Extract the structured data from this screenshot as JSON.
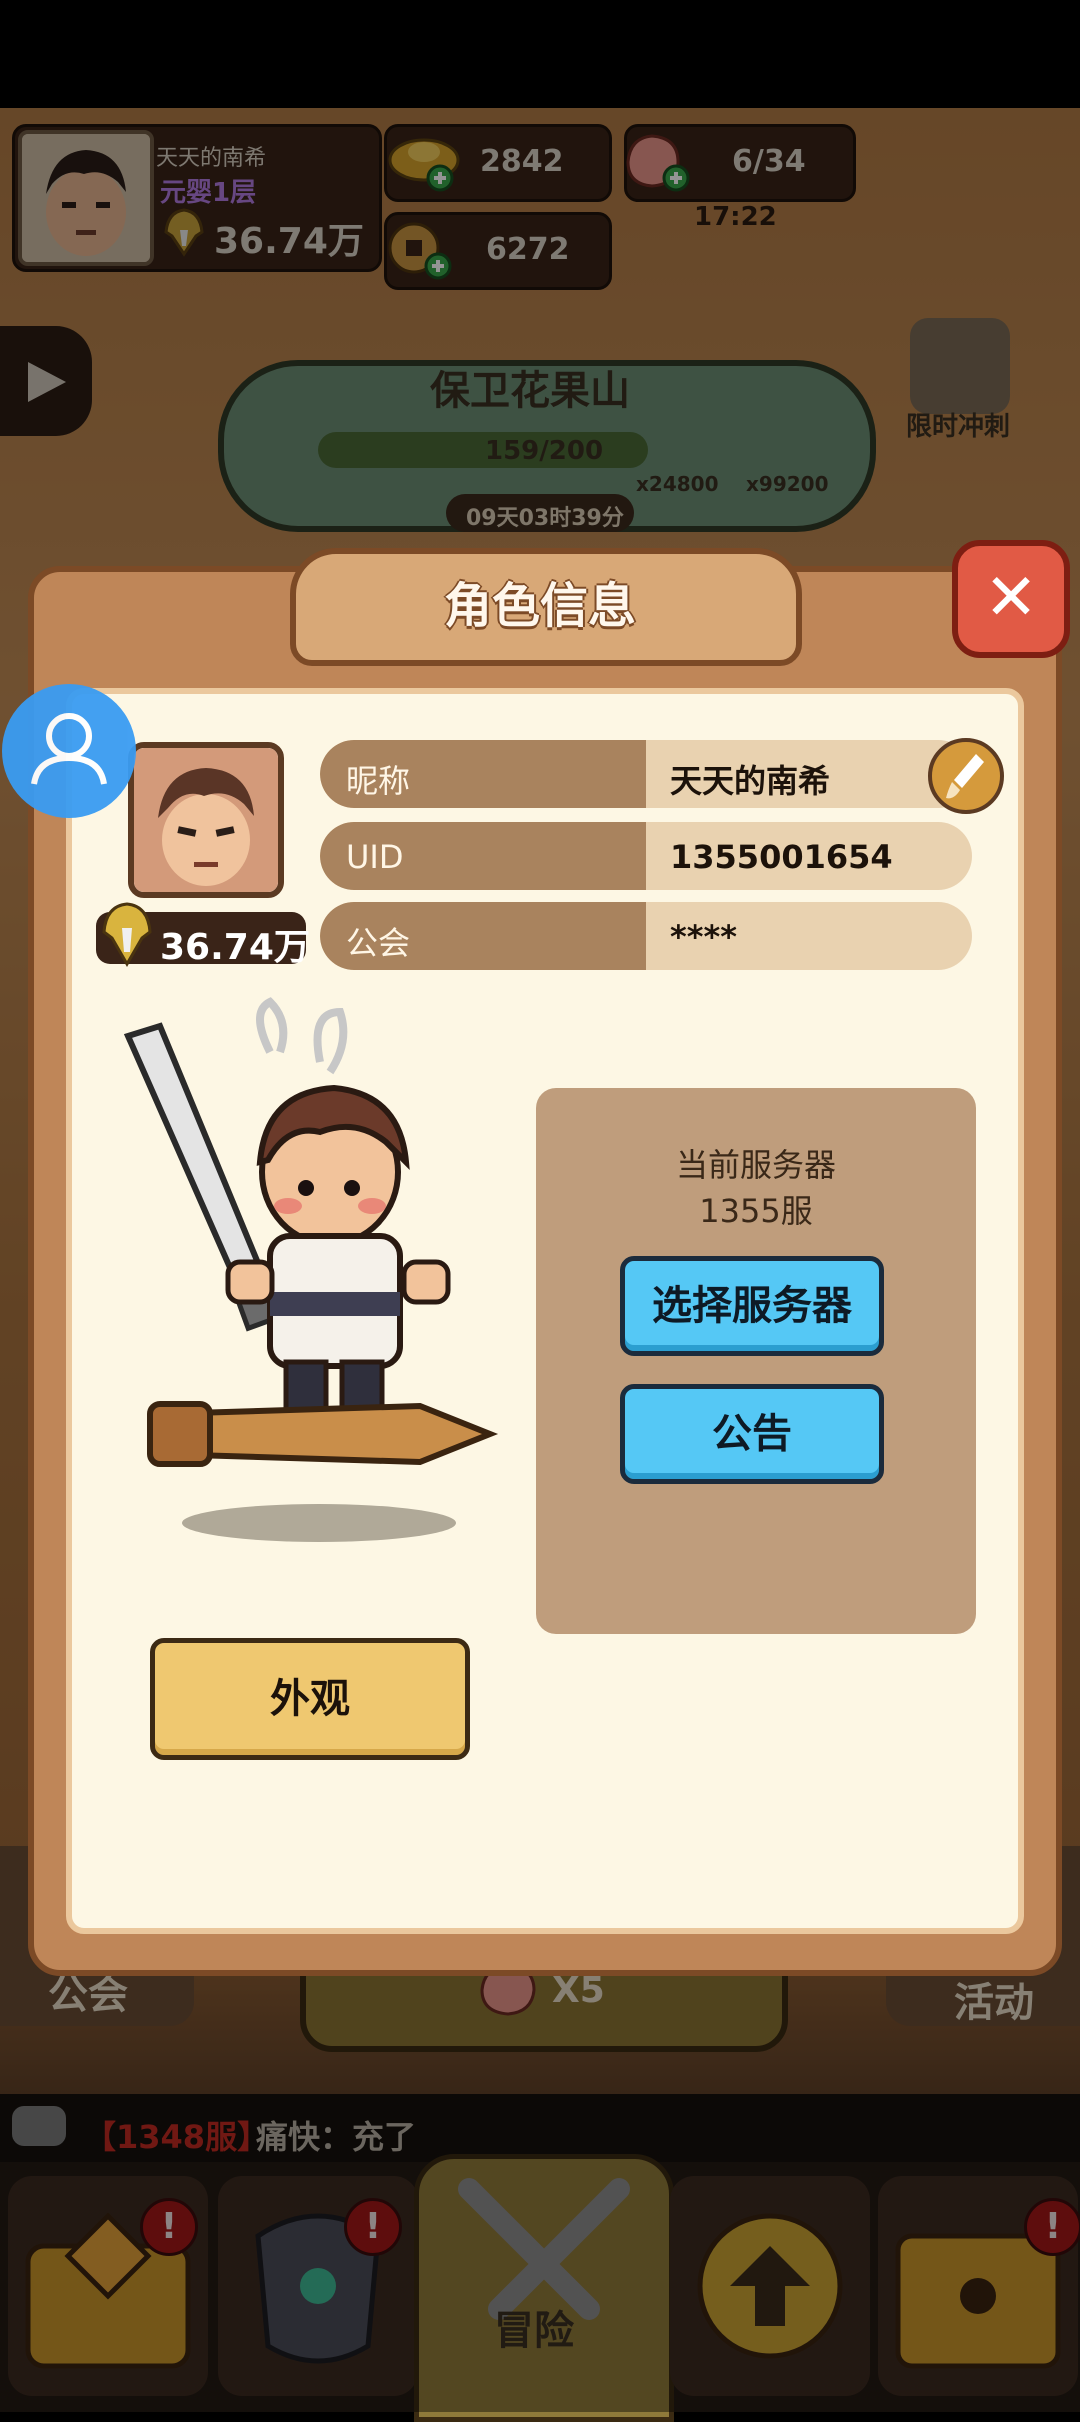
{
  "top_bar": {
    "player_name": "天天的南希",
    "player_rank": "元婴1层",
    "player_power": "36.74万",
    "gold": "2842",
    "coins": "6272",
    "peaches": "6/34",
    "peach_timer": "17:22"
  },
  "event": {
    "title": "保卫花果山",
    "progress": "159/200",
    "reward1": "x24800",
    "reward2": "x99200",
    "countdown": "09天03时39分",
    "limited_label": "限时冲刺"
  },
  "side_buttons": {
    "guild": "公会",
    "activity": "活动",
    "peach_count": "X5"
  },
  "chat": {
    "server_tag": "【1348服】",
    "message": "痛快：充了"
  },
  "nav": {
    "adventure": "冒险",
    "badge": "!"
  },
  "dialog": {
    "title": "角色信息",
    "close_glyph": "✕",
    "power": "36.74万",
    "rows": [
      {
        "label": "昵称",
        "value": "天天的南希"
      },
      {
        "label": "UID",
        "value": "1355001654"
      },
      {
        "label": "公会",
        "value": "****"
      }
    ],
    "server_heading": "当前服务器",
    "server_name": "1355服",
    "select_server_button": "选择服务器",
    "notice_button": "公告",
    "appearance_button": "外观"
  },
  "colors": {
    "accent_blue": "#55c8f5",
    "dialog_frame": "#bf8658",
    "close_red": "#e15a45",
    "button_yellow": "#efc870"
  },
  "icons": [
    "gold-ingot-icon",
    "copper-coin-icon",
    "peach-icon",
    "play-icon",
    "hourglass-icon",
    "close-icon",
    "brush-icon",
    "helmet-power-icon",
    "user-icon",
    "chat-icon",
    "treasure-chest-icon",
    "armor-icon",
    "crossed-swords-icon",
    "upgrade-arrow-icon",
    "locked-chest-icon"
  ]
}
